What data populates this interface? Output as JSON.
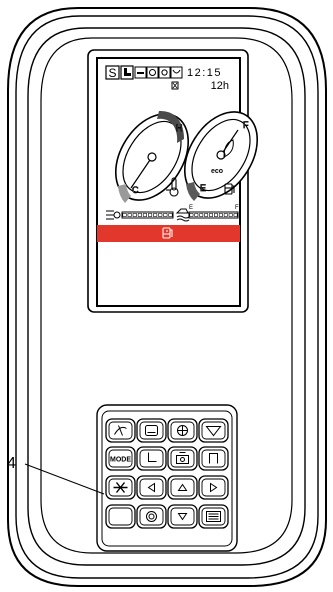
{
  "screen": {
    "mode_letter": "S",
    "time": "12:15",
    "hours": "12h",
    "temp_gauge": {
      "high_label": "H",
      "cold_label": "C"
    },
    "fuel_gauge": {
      "full_label": "F",
      "empty_label": "E",
      "eco_label": "eco"
    },
    "level_bar_left": {
      "segments": 10
    },
    "level_bar_right": {
      "empty_label": "E",
      "full_label": "F",
      "segments": 10
    },
    "alert_bar_color": "#e2382c"
  },
  "keypad": {
    "rows": [
      [
        "scoop-icon",
        "wiper-front-icon",
        "fan-icon",
        "wiper-icon"
      ],
      [
        "MODE",
        "seat-icon",
        "operator-icon",
        "door-icon"
      ],
      [
        "washer-icon",
        "left-arrow",
        "up-arrow",
        "right-arrow"
      ],
      [
        "blank-key",
        "camera-icon",
        "down-arrow",
        "menu-icon"
      ]
    ],
    "mode_label": "MODE"
  },
  "callout": {
    "number": "4"
  }
}
